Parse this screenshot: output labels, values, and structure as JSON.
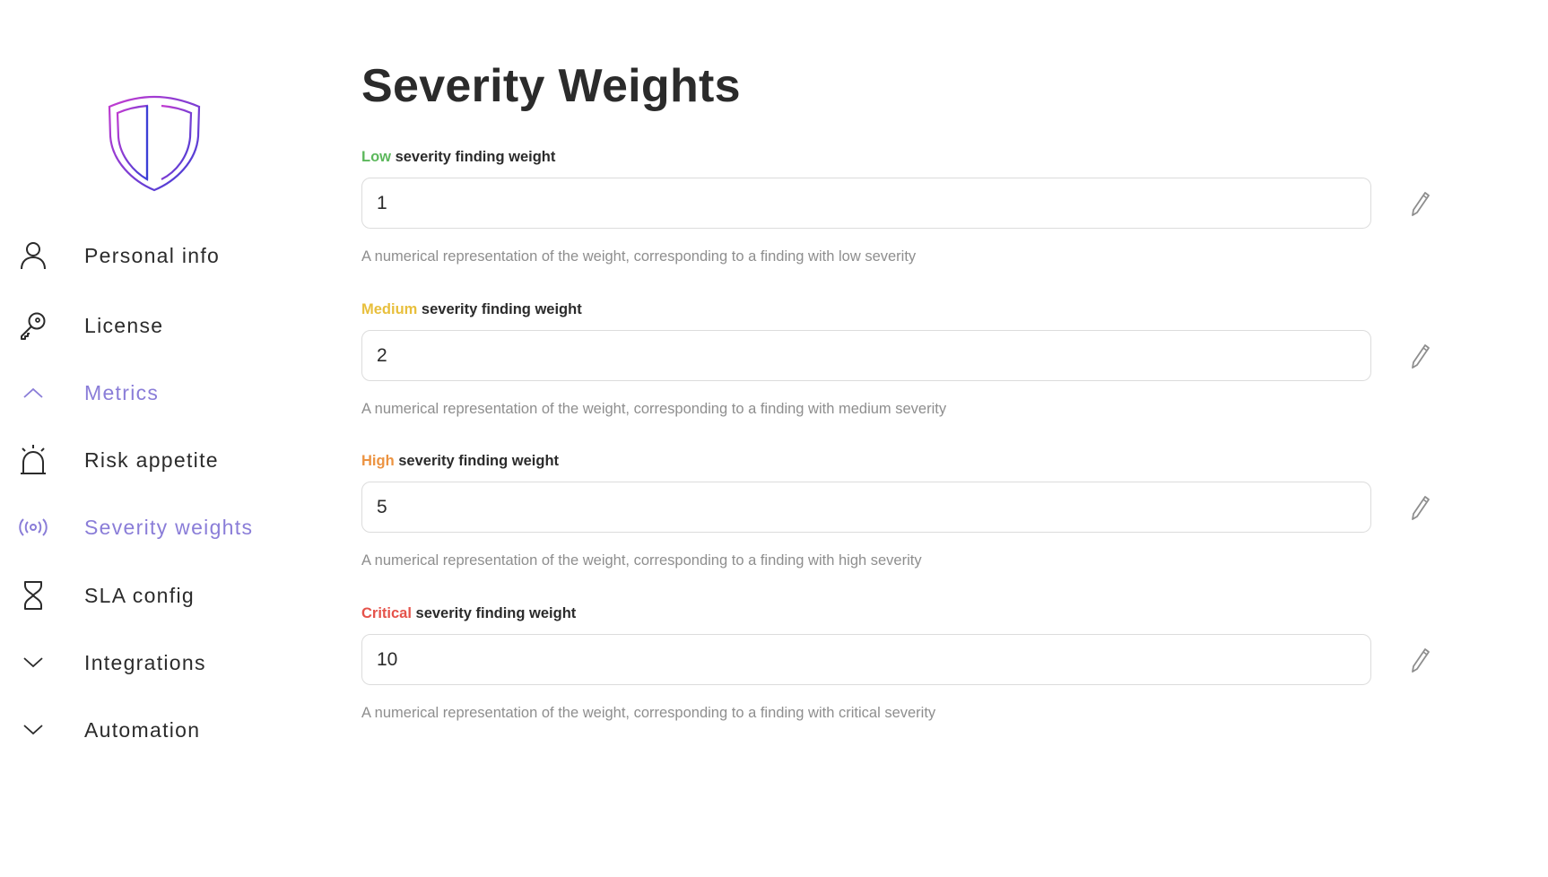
{
  "sidebar": {
    "items": [
      {
        "label": "Personal info",
        "icon": "user-icon"
      },
      {
        "label": "License",
        "icon": "key-icon"
      },
      {
        "label": "Metrics",
        "icon": "chevron-up-icon",
        "active": true
      },
      {
        "label": "Risk appetite",
        "icon": "alarm-icon"
      },
      {
        "label": "Severity weights",
        "icon": "broadcast-icon",
        "active": true
      },
      {
        "label": "SLA config",
        "icon": "hourglass-icon"
      },
      {
        "label": "Integrations",
        "icon": "chevron-down-icon"
      },
      {
        "label": "Automation",
        "icon": "chevron-down-icon"
      }
    ]
  },
  "main": {
    "title": "Severity Weights",
    "fields": [
      {
        "severity": "Low",
        "label_rest": " severity finding weight",
        "value": "1",
        "help": "A numerical representation of the weight, corresponding to a finding with low severity",
        "color": "#5cb85c"
      },
      {
        "severity": "Medium",
        "label_rest": " severity finding weight",
        "value": "2",
        "help": "A numerical representation of the weight, corresponding to a finding with medium severity",
        "color": "#e8bf3c"
      },
      {
        "severity": "High",
        "label_rest": " severity finding weight",
        "value": "5",
        "help": "A numerical representation of the weight, corresponding to a finding with high severity",
        "color": "#ec9341"
      },
      {
        "severity": "Critical",
        "label_rest": " severity finding weight",
        "value": "10",
        "help": "A numerical representation of the weight, corresponding to a finding with critical severity",
        "color": "#e5534b"
      }
    ]
  },
  "colors": {
    "accent": "#8a7dd8",
    "text": "#2b2b2b",
    "muted": "#8e8e8e",
    "border": "#dcdcdc"
  }
}
